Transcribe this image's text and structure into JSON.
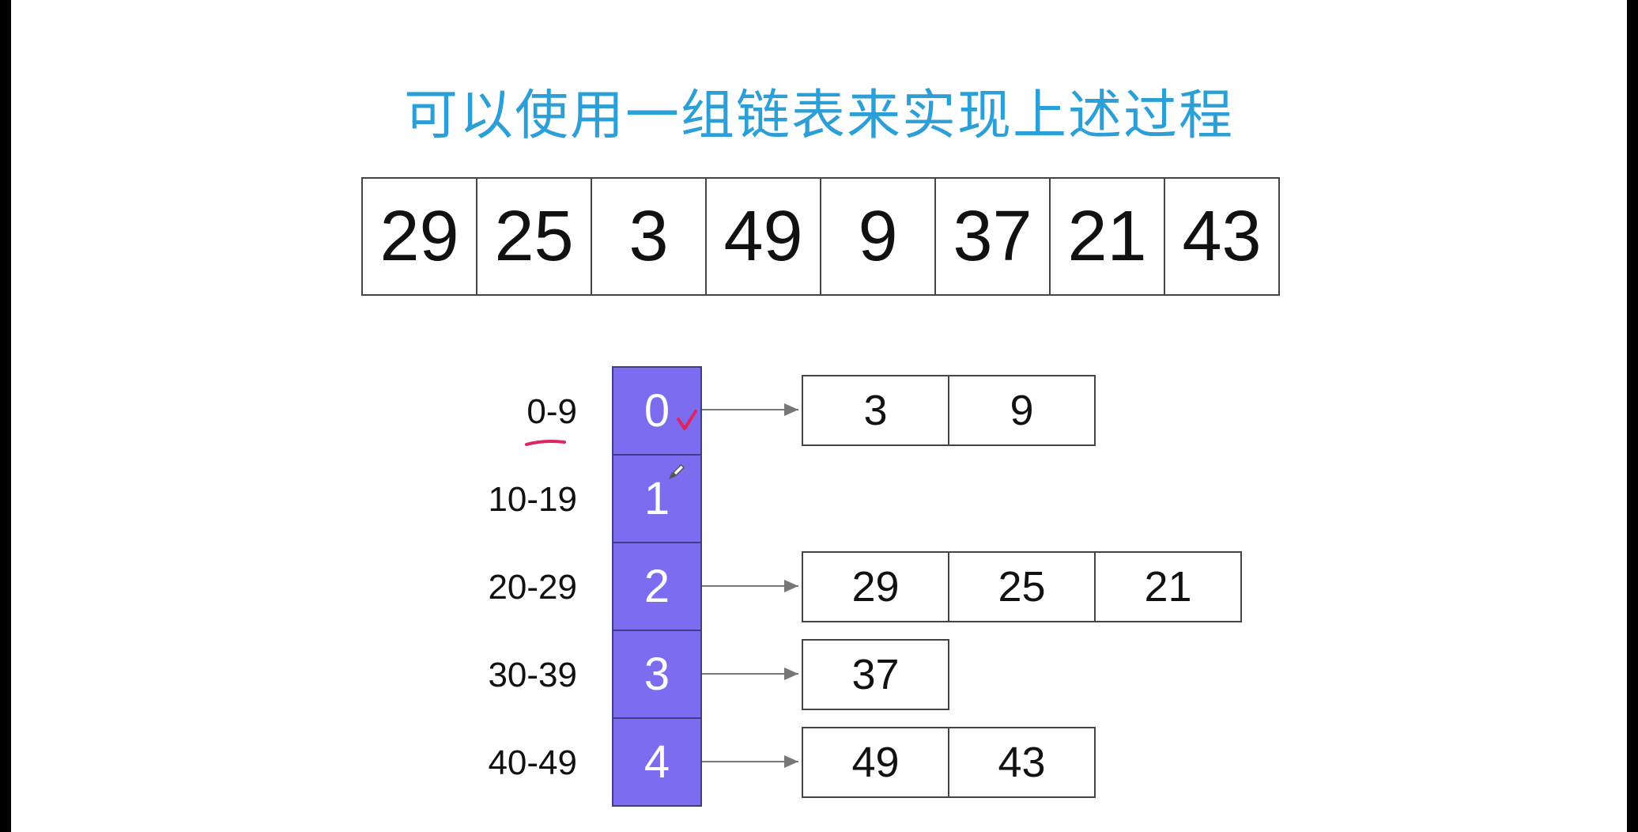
{
  "title": "可以使用一组链表来实现上述过程",
  "array": [
    "29",
    "25",
    "3",
    "49",
    "9",
    "37",
    "21",
    "43"
  ],
  "buckets": [
    {
      "range": "0-9",
      "index": "0",
      "items": [
        "3",
        "9"
      ]
    },
    {
      "range": "10-19",
      "index": "1",
      "items": []
    },
    {
      "range": "20-29",
      "index": "2",
      "items": [
        "29",
        "25",
        "21"
      ]
    },
    {
      "range": "30-39",
      "index": "3",
      "items": [
        "37"
      ]
    },
    {
      "range": "40-49",
      "index": "4",
      "items": [
        "49",
        "43"
      ]
    }
  ],
  "colors": {
    "title": "#2b9fd6",
    "bucket_fill": "#7b6cf0",
    "annotation": "#e0245e"
  }
}
